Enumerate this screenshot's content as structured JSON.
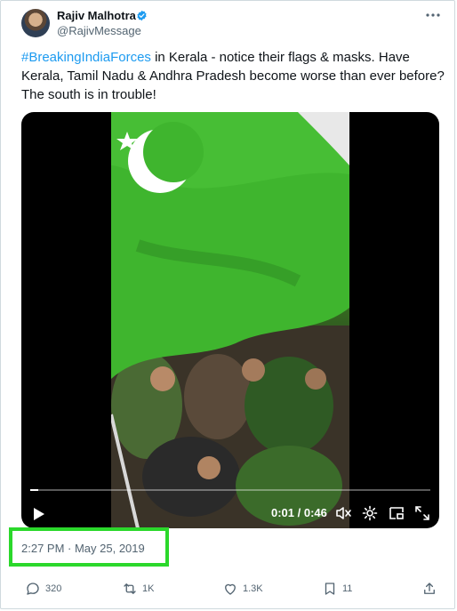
{
  "author": {
    "name": "Rajiv Malhotra",
    "handle": "@RajivMessage"
  },
  "tweet": {
    "hashtag": "#BreakingIndiaForces",
    "text": " in Kerala - notice their flags & masks. Have Kerala, Tamil Nadu & Andhra Pradesh become worse than ever before? The south is in trouble!"
  },
  "video": {
    "time_readout": "0:01 / 0:46",
    "progress": 0.02
  },
  "timestamp": "2:27 PM · May 25, 2019",
  "actions": {
    "replies": "320",
    "reposts": "1K",
    "likes": "1.3K",
    "bookmarks": "11"
  },
  "colors": {
    "accent": "#1d9bf0",
    "highlight_box": "#2bd82b",
    "flag_green": "#3fb52e"
  },
  "icons": [
    "verified-badge-icon",
    "more-icon",
    "play-icon",
    "mute-icon",
    "settings-icon",
    "pip-icon",
    "fullscreen-icon",
    "reply-icon",
    "repost-icon",
    "like-icon",
    "bookmark-icon",
    "share-icon"
  ]
}
